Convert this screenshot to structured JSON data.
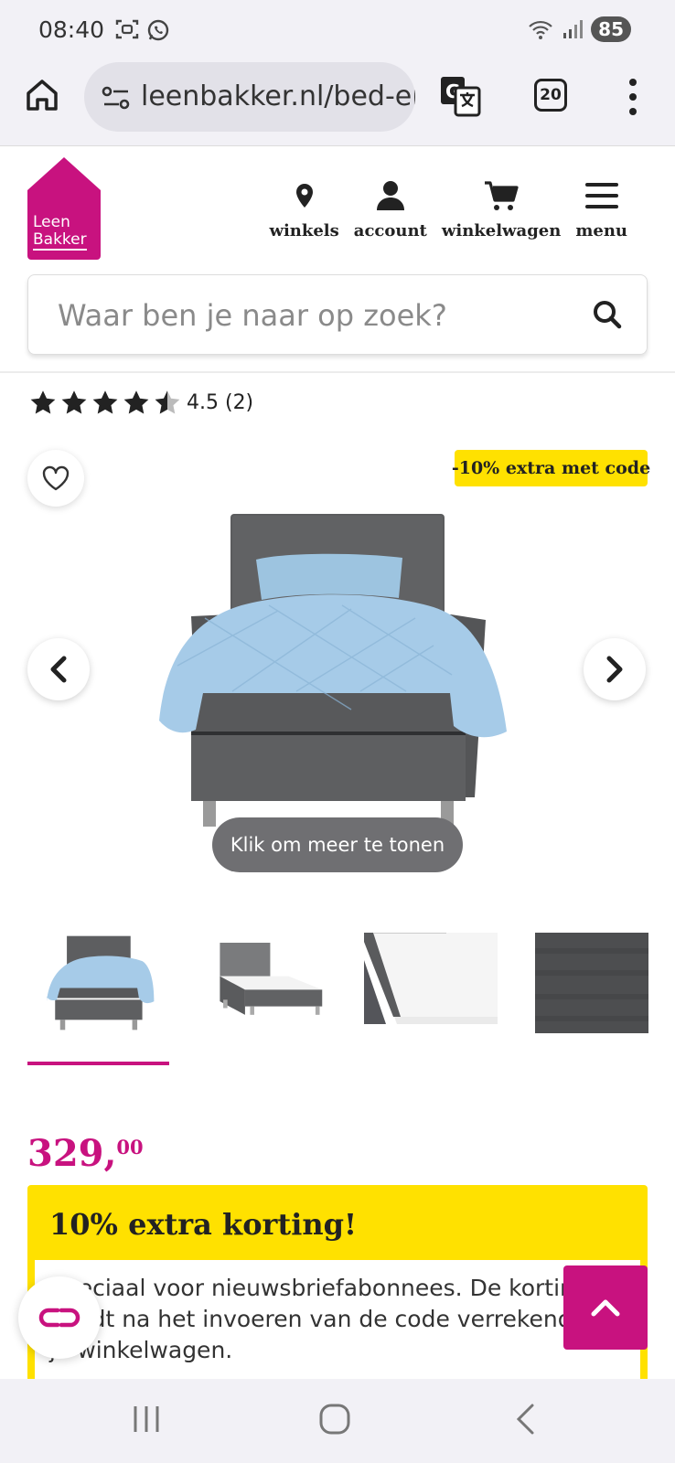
{
  "status_bar": {
    "time": "08:40",
    "battery": "85"
  },
  "browser": {
    "url": "leenbakker.nl/bed-en",
    "tab_count": "20"
  },
  "site": {
    "logo_line1": "Leen",
    "logo_line2": "Bakker",
    "brand_color": "#c8127f",
    "accent_yellow": "#ffe100",
    "nav": [
      {
        "label": "winkels",
        "icon": "map-pin-icon"
      },
      {
        "label": "account",
        "icon": "user-icon"
      },
      {
        "label": "winkelwagen",
        "icon": "cart-icon"
      },
      {
        "label": "menu",
        "icon": "hamburger-icon"
      }
    ],
    "search_placeholder": "Waar ben je naar op zoek?"
  },
  "product": {
    "rating_text": "4.5 (2)",
    "rating_value": 4.5,
    "promo_badge": "-10% extra met code",
    "more_pill": "Klik om meer te tonen",
    "price_main": "329,",
    "price_cents": "00",
    "thumbnail_count": 4,
    "active_thumbnail": 1
  },
  "discount": {
    "title": "10% extra korting!",
    "body": "Speciaal voor nieuwsbriefabonnees. De korting wordt na het invoeren van de code verrekend in je winkelwagen."
  }
}
